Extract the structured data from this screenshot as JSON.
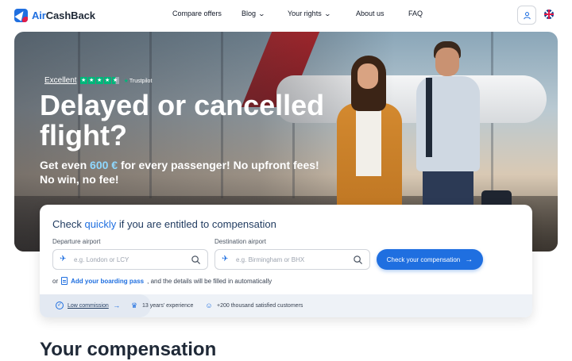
{
  "header": {
    "logo": {
      "prefix": "Air",
      "suffix": "CashBack"
    },
    "nav": [
      {
        "label": "Compare offers",
        "dropdown": false
      },
      {
        "label": "Blog",
        "dropdown": true
      },
      {
        "label": "Your rights",
        "dropdown": true
      },
      {
        "label": "About us",
        "dropdown": false
      },
      {
        "label": "FAQ",
        "dropdown": false
      }
    ],
    "user_icon": "user-icon",
    "language_flag": "uk-flag-icon"
  },
  "hero": {
    "trustpilot": {
      "rating_label": "Excellent",
      "stars": 4.5,
      "brand": "Trustpilot"
    },
    "title": "Delayed or cancelled flight?",
    "subtitle_pre": "Get even ",
    "subtitle_amount": "600 €",
    "subtitle_post": " for every passenger! No upfront fees!",
    "subtitle_line2": "No win, no fee!"
  },
  "form": {
    "title_pre": "Check ",
    "title_highlight": "quickly",
    "title_post": " if you are entitled to compensation",
    "departure": {
      "label": "Departure airport",
      "placeholder": "e.g. London or LCY"
    },
    "destination": {
      "label": "Destination airport",
      "placeholder": "e.g. Birmingham or BHX"
    },
    "cta": "Check your compensation",
    "boarding_or": "or",
    "boarding_link": "Add your boarding pass",
    "boarding_post": ", and the details will be filled in automatically"
  },
  "benefits": [
    {
      "label": "Low commission",
      "icon": "check-circle-icon"
    },
    {
      "label": "13 years' experience",
      "icon": "crown-icon"
    },
    {
      "label": "+200 thousand satisfied customers",
      "icon": "smile-icon"
    }
  ],
  "section": {
    "title": "Your compensation"
  },
  "colors": {
    "accent": "#1f6fe0",
    "trustpilot_green": "#00b67a"
  }
}
